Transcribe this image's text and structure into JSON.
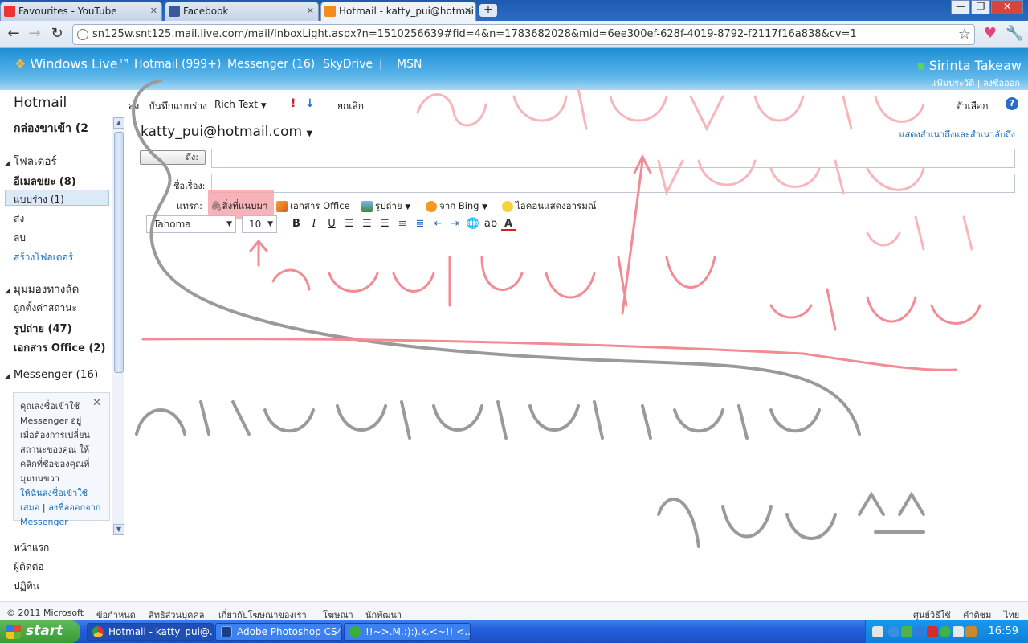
{
  "browser": {
    "tabs": [
      {
        "label": "Favourites - YouTube",
        "icon": "youtube-icon"
      },
      {
        "label": "Facebook",
        "icon": "facebook-icon"
      },
      {
        "label": "Hotmail - katty_pui@hotmail.c",
        "icon": "hotmail-icon",
        "active": true
      }
    ],
    "url": "sn125w.snt125.mail.live.com/mail/InboxLight.aspx?n=1510256639#fid=4&n=1783682028&mid=6ee300ef-628f-4019-8792-f2117f16a838&cv=1"
  },
  "wl_header": {
    "logo": "Windows Live™",
    "nav": [
      "Hotmail (999+)",
      "Messenger (16)",
      "SkyDrive",
      "MSN"
    ],
    "user_name": "Sirinta Takeaw",
    "profile_link": "แฟ้มประวัติ",
    "signout_link": "ลงชื่อออก"
  },
  "sidebar": {
    "title": "Hotmail",
    "inbox": "กล่องขาเข้า (2",
    "folders_heading": "โฟลเดอร์",
    "folders": [
      "อีเมลขยะ (8)",
      "แบบร่าง (1)",
      "ส่ง",
      "ลบ"
    ],
    "create_folder": "สร้างโฟลเดอร์",
    "quickviews_heading": "มุมมองทางลัด",
    "quickviews": [
      "ถูกตั้งค่าสถานะ",
      "รูปถ่าย (47)",
      "เอกสาร Office (2)"
    ],
    "messenger_heading": "Messenger (16)",
    "messenger_box": {
      "text": "คุณลงชื่อเข้าใช้ Messenger อยู่ เมื่อต้องการเปลี่ยนสถานะของคุณ ให้คลิกที่ชื่อของคุณที่มุมบนขวา",
      "link1": "ให้ฉันลงชื่อเข้าใช้เสมอ",
      "sep": "|",
      "link2": "ลงชื่อออกจาก Messenger"
    },
    "bottom_links": [
      "หน้าแรก",
      "ผู้ติดต่อ",
      "ปฏิทิน"
    ]
  },
  "compose_toolbar": {
    "send": "ส่ง",
    "save_draft": "บันทึกแบบร่าง",
    "rich_text": "Rich Text",
    "cancel": "ยกเลิก",
    "options": "ตัวเลือก"
  },
  "compose": {
    "from": "katty_pui@hotmail.com",
    "show_cc_bcc": "แสดงสำเนาถึงและสำเนาลับถึง",
    "to_label": "ถึง:",
    "subject_label": "ชื่อเรื่อง:",
    "insert_label": "แทรก:",
    "insert_items": [
      "สิ่งที่แนบมา",
      "เอกสาร Office",
      "รูปถ่าย",
      "จาก Bing",
      "ไอคอนแสดงอารมณ์"
    ],
    "font": "Tahoma",
    "size": "10"
  },
  "footer": {
    "copyright": "© 2011 Microsoft",
    "links": [
      "ข้อกำหนด",
      "สิทธิส่วนบุคคล",
      "เกี่ยวกับโฆษณาของเรา",
      "โฆษณา",
      "นักพัฒนา"
    ],
    "right_links": [
      "ศูนย์วิธีใช้",
      "คำติชม",
      "ไทย"
    ]
  },
  "taskbar": {
    "start": "start",
    "tasks": [
      "Hotmail - katty_pui@...",
      "Adobe Photoshop CS4",
      "!!~>.M.:):).k.<~!! <..."
    ],
    "clock": "16:59"
  }
}
